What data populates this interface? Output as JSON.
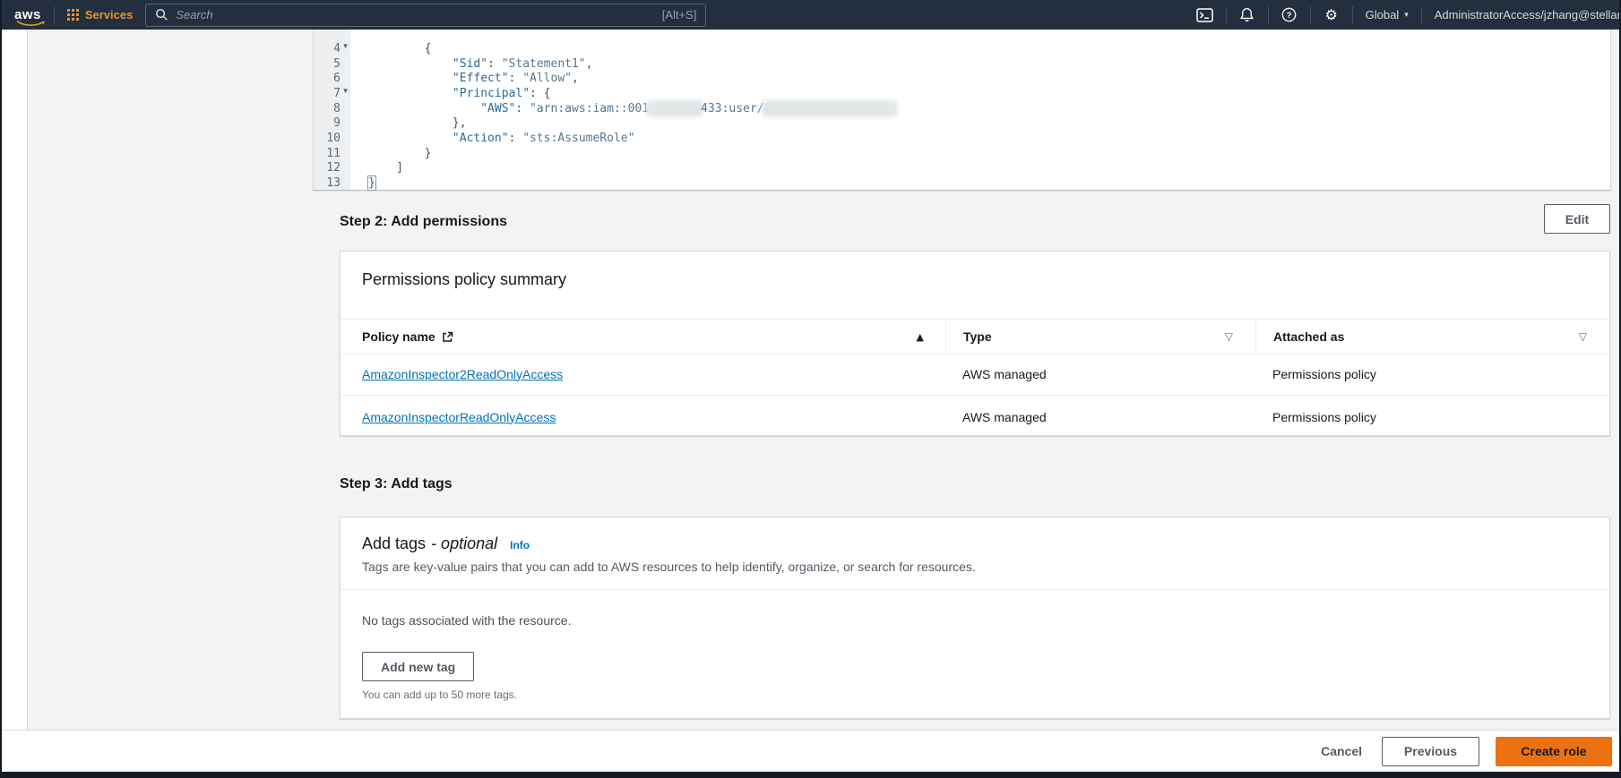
{
  "topnav": {
    "logo_text": "aws",
    "services_label": "Services",
    "search_placeholder": "Search",
    "search_shortcut": "[Alt+S]",
    "region_label": "Global",
    "account_label": "AdministratorAccess/jzhang@stellar"
  },
  "editor": {
    "lines": [
      {
        "num": "4",
        "fold": true,
        "segments": [
          {
            "c": "p",
            "t": "        {"
          }
        ]
      },
      {
        "num": "5",
        "fold": false,
        "segments": [
          {
            "c": "p",
            "t": "            "
          },
          {
            "c": "k",
            "t": "\"Sid\""
          },
          {
            "c": "p",
            "t": ": "
          },
          {
            "c": "s",
            "t": "\"Statement1\""
          },
          {
            "c": "p",
            "t": ","
          }
        ]
      },
      {
        "num": "6",
        "fold": false,
        "segments": [
          {
            "c": "p",
            "t": "            "
          },
          {
            "c": "k",
            "t": "\"Effect\""
          },
          {
            "c": "p",
            "t": ": "
          },
          {
            "c": "s",
            "t": "\"Allow\""
          },
          {
            "c": "p",
            "t": ","
          }
        ]
      },
      {
        "num": "7",
        "fold": true,
        "segments": [
          {
            "c": "p",
            "t": "            "
          },
          {
            "c": "k",
            "t": "\"Principal\""
          },
          {
            "c": "p",
            "t": ": {"
          }
        ]
      },
      {
        "num": "8",
        "fold": false,
        "segments": [
          {
            "c": "p",
            "t": "                "
          },
          {
            "c": "k",
            "t": "\"AWS\""
          },
          {
            "c": "p",
            "t": ": "
          },
          {
            "c": "s",
            "t": "\"arn:aws:iam::001"
          },
          {
            "blur": 58
          },
          {
            "c": "s",
            "t": "433:user/"
          },
          {
            "blur": 146
          }
        ]
      },
      {
        "num": "9",
        "fold": false,
        "segments": [
          {
            "c": "p",
            "t": "            },"
          }
        ]
      },
      {
        "num": "10",
        "fold": false,
        "segments": [
          {
            "c": "p",
            "t": "            "
          },
          {
            "c": "k",
            "t": "\"Action\""
          },
          {
            "c": "p",
            "t": ": "
          },
          {
            "c": "s",
            "t": "\"sts:AssumeRole\""
          }
        ]
      },
      {
        "num": "11",
        "fold": false,
        "segments": [
          {
            "c": "p",
            "t": "        }"
          }
        ]
      },
      {
        "num": "12",
        "fold": false,
        "segments": [
          {
            "c": "p",
            "t": "    ]"
          }
        ]
      },
      {
        "num": "13",
        "fold": false,
        "segments": [
          {
            "c": "p cur",
            "t": "}"
          }
        ]
      }
    ]
  },
  "step2": {
    "heading": "Step 2: Add permissions",
    "edit_button": "Edit",
    "panel": {
      "title": "Permissions policy summary",
      "columns": [
        {
          "label": "Policy name"
        },
        {
          "label": "Type"
        },
        {
          "label": "Attached as"
        }
      ],
      "rows": [
        {
          "policy_name": "AmazonInspector2ReadOnlyAccess",
          "type": "AWS managed",
          "attached_as": "Permissions policy"
        },
        {
          "policy_name": "AmazonInspectorReadOnlyAccess",
          "type": "AWS managed",
          "attached_as": "Permissions policy"
        }
      ]
    }
  },
  "step3": {
    "heading": "Step 3: Add tags",
    "panel": {
      "title": "Add tags",
      "title_suffix": "- optional",
      "info_link": "Info",
      "description": "Tags are key-value pairs that you can add to AWS resources to help identify, organize, or search for resources.",
      "empty_text": "No tags associated with the resource.",
      "add_button": "Add new tag",
      "limit_text": "You can add up to 50 more tags."
    }
  },
  "footer": {
    "cancel": "Cancel",
    "previous": "Previous",
    "create": "Create role"
  },
  "colors": {
    "nav_bg": "#232f3e",
    "accent_orange": "#ec7211",
    "link_blue": "#0073bb",
    "page_bg": "#f2f3f3"
  }
}
